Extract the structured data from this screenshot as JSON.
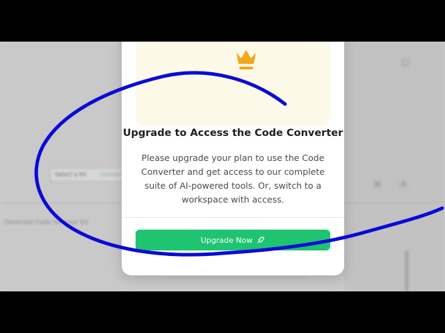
{
  "modal": {
    "title": "Upgrade to Access the Code Converter",
    "description": "Please upgrade your plan to use the Code Converter and get access to our complete suite of AI-powered tools. Or, switch to a workspace with access.",
    "upgrade_button_label": "Upgrade Now",
    "hero_icon": "crown-icon",
    "button_icon": "rocket-icon"
  },
  "background": {
    "chip_text": "Select a Kit",
    "chip_status": "Connected",
    "row_text": "Generate Code for your Kit"
  },
  "colors": {
    "accent": "#1fc471",
    "hero_bg": "#fdf9e8",
    "crown": "#f2a81d",
    "annotation_ink": "#0a0ad6"
  }
}
